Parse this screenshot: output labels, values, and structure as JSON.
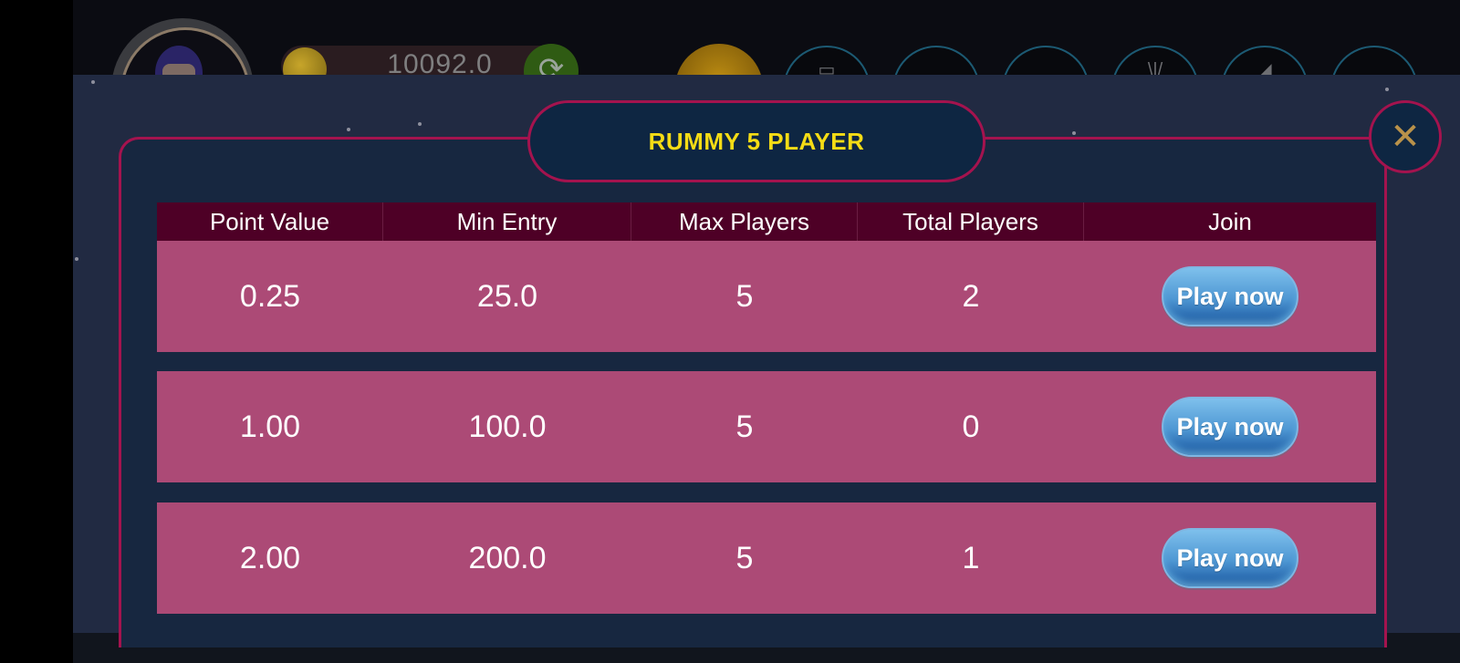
{
  "hud": {
    "coin_balance": "10092.0",
    "avatar_icon": "avatar-icon",
    "coin_icon": "coin-icon",
    "refresh_icon": "refresh-icon",
    "refresh_glyph": "⟳",
    "icons": [
      {
        "name": "gift-icon",
        "glyph": "▭"
      },
      {
        "name": "menu-icon-2",
        "glyph": ""
      },
      {
        "name": "menu-icon-3",
        "glyph": ""
      },
      {
        "name": "bulb-icon",
        "glyph": "\\|/"
      },
      {
        "name": "megaphone-icon",
        "glyph": "◢"
      },
      {
        "name": "settings-icon",
        "glyph": ""
      }
    ]
  },
  "modal": {
    "title": "RUMMY 5 PLAYER",
    "close_glyph": "✕",
    "columns": [
      "Point Value",
      "Min Entry",
      "Max Players",
      "Total Players",
      "Join"
    ],
    "rows": [
      {
        "point_value": "0.25",
        "min_entry": "25.0",
        "max_players": "5",
        "total_players": "2",
        "join_label": "Play now"
      },
      {
        "point_value": "1.00",
        "min_entry": "100.0",
        "max_players": "5",
        "total_players": "0",
        "join_label": "Play now"
      },
      {
        "point_value": "2.00",
        "min_entry": "200.0",
        "max_players": "5",
        "total_players": "1",
        "join_label": "Play now"
      }
    ]
  },
  "colors": {
    "title_text": "#f5dc15",
    "border_accent": "#a4134e",
    "header_bg": "#4e0026",
    "row_bg": "#ac4a76",
    "button_blue": "#4e97d3",
    "close_icon": "#b9924a"
  }
}
